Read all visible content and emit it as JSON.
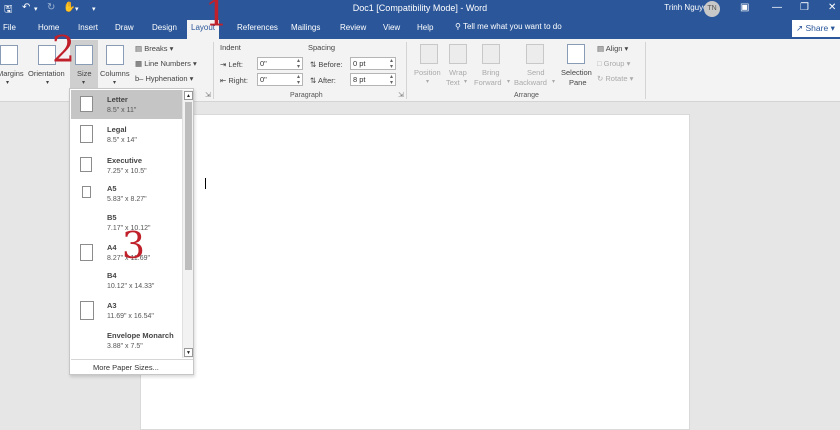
{
  "titlebar": {
    "doc_title": "Doc1 [Compatibility Mode]  -  Word",
    "user_name": "Trinh Nguyen",
    "avatar_initials": "TN",
    "save_icon": "save-icon",
    "undo_icon": "undo-icon",
    "redo_icon": "redo-icon",
    "accent": "#2b579a"
  },
  "tabs": [
    "File",
    "Home",
    "Insert",
    "Draw",
    "Design",
    "Layout",
    "References",
    "Mailings",
    "Review",
    "View",
    "Help"
  ],
  "tell_me": "Tell me what you want to do",
  "share_label": "Share",
  "ribbon": {
    "margins": "Margins",
    "orientation": "Orientation",
    "size": "Size",
    "columns": "Columns",
    "breaks": "Breaks",
    "line_numbers": "Line Numbers",
    "hyphenation": "Hyphenation",
    "indent_heading": "Indent",
    "spacing_heading": "Spacing",
    "left_label": "Left:",
    "left_value": "0\"",
    "right_label": "Right:",
    "right_value": "0\"",
    "before_label": "Before:",
    "before_value": "0 pt",
    "after_label": "After:",
    "after_value": "8 pt",
    "paragraph_group": "Paragraph",
    "position": "Position",
    "wrap_text_1": "Wrap",
    "wrap_text_2": "Text",
    "bring_forward_1": "Bring",
    "bring_forward_2": "Forward",
    "send_backward_1": "Send",
    "send_backward_2": "Backward",
    "selection_pane_1": "Selection",
    "selection_pane_2": "Pane",
    "align": "Align",
    "group": "Group",
    "rotate": "Rotate",
    "arrange_group": "Arrange"
  },
  "size_dropdown": {
    "items": [
      {
        "name": "Letter",
        "dims": "8.5\" x 11\""
      },
      {
        "name": "Legal",
        "dims": "8.5\" x 14\""
      },
      {
        "name": "Executive",
        "dims": "7.25\" x 10.5\""
      },
      {
        "name": "A5",
        "dims": "5.83\" x 8.27\""
      },
      {
        "name": "B5",
        "dims": "7.17\" x 10.12\""
      },
      {
        "name": "A4",
        "dims": "8.27\" x 11.69\""
      },
      {
        "name": "B4",
        "dims": "10.12\" x 14.33\""
      },
      {
        "name": "A3",
        "dims": "11.69\" x 16.54\""
      },
      {
        "name": "Envelope Monarch",
        "dims": "3.88\" x 7.5\""
      }
    ],
    "selected": "Letter",
    "more_label": "More Paper Sizes..."
  },
  "annotations": {
    "step1": "1",
    "step2": "2",
    "step3": "3",
    "color": "#c0202a"
  }
}
